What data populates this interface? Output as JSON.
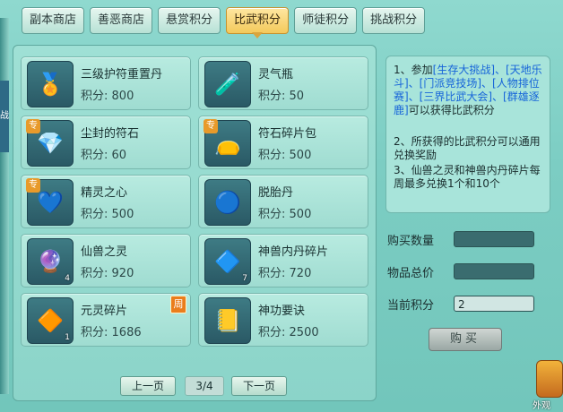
{
  "tabs": [
    "副本商店",
    "善恶商店",
    "悬赏积分",
    "比武积分",
    "师徒积分",
    "挑战积分"
  ],
  "active_tab": 3,
  "left_edge_label": "战",
  "points_label": "积分:",
  "items": [
    {
      "name": "三级护符重置丹",
      "points": "800",
      "icon": "gold-medal-icon",
      "symbol": "🏅",
      "tag": "",
      "count": "",
      "weekly": ""
    },
    {
      "name": "灵气瓶",
      "points": "50",
      "icon": "potion-bottle-icon",
      "symbol": "🧪",
      "tag": "",
      "count": "",
      "weekly": ""
    },
    {
      "name": "尘封的符石",
      "points": "60",
      "icon": "gem-stone-icon",
      "symbol": "💎",
      "tag": "专",
      "count": "",
      "weekly": ""
    },
    {
      "name": "符石碎片包",
      "points": "500",
      "icon": "red-bag-icon",
      "symbol": "👝",
      "tag": "专",
      "count": "",
      "weekly": ""
    },
    {
      "name": "精灵之心",
      "points": "500",
      "icon": "spirit-heart-icon",
      "symbol": "💙",
      "tag": "专",
      "count": "",
      "weekly": ""
    },
    {
      "name": "脱胎丹",
      "points": "500",
      "icon": "blue-pill-icon",
      "symbol": "🔵",
      "tag": "",
      "count": "",
      "weekly": ""
    },
    {
      "name": "仙兽之灵",
      "points": "920",
      "icon": "spirit-orb-icon",
      "symbol": "🔮",
      "tag": "",
      "count": "4",
      "weekly": ""
    },
    {
      "name": "神兽内丹碎片",
      "points": "720",
      "icon": "purple-shard-icon",
      "symbol": "🔷",
      "tag": "",
      "count": "7",
      "weekly": ""
    },
    {
      "name": "元灵碎片",
      "points": "1686",
      "icon": "gold-shard-icon",
      "symbol": "🔶",
      "tag": "",
      "count": "1",
      "weekly": "周"
    },
    {
      "name": "神功要诀",
      "points": "2500",
      "icon": "golden-book-icon",
      "symbol": "📒",
      "tag": "",
      "count": "",
      "weekly": ""
    }
  ],
  "info": {
    "l1_a": "1、参加",
    "l1_links": "[生存大挑战]、[天地乐斗]、[门派竞技场]、[人物排位赛]、[三界比武大会]、[群雄逐鹿]",
    "l1_b": "可以获得比武积分",
    "l2": "2、所获得的比武积分可以通用兑换奖励",
    "l3": "3、仙兽之灵和神兽内丹碎片每周最多兑换1个和10个"
  },
  "form": {
    "qty_label": "购买数量",
    "qty_value": "",
    "total_label": "物品总价",
    "total_value": "",
    "current_label": "当前积分",
    "current_value": "2",
    "buy_label": "购买"
  },
  "pager": {
    "prev": "上一页",
    "page": "3/4",
    "next": "下一页"
  },
  "corner_label": "外观",
  "colors": {
    "active_tab": "#f3c95b",
    "panel": "#8bd4c9",
    "link": "#1664d9"
  }
}
